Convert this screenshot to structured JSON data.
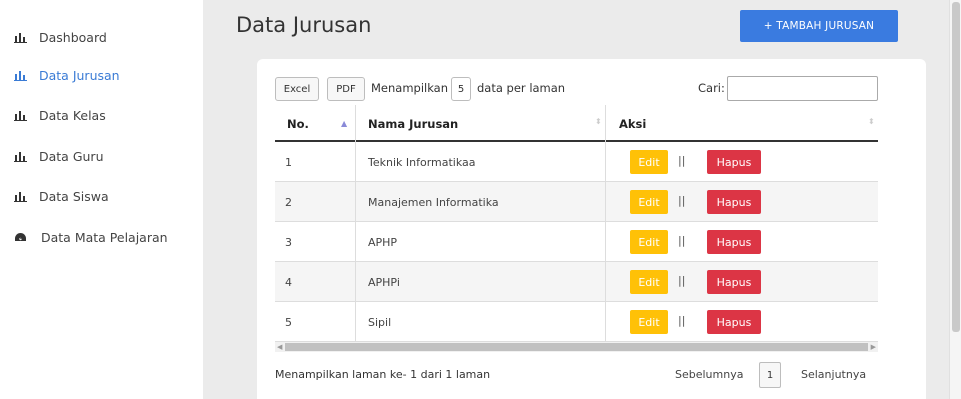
{
  "sidebar": {
    "items": [
      {
        "label": "Dashboard",
        "icon": "bar-chart-icon",
        "active": false
      },
      {
        "label": "Data Jurusan",
        "icon": "bar-chart-icon",
        "active": true
      },
      {
        "label": "Data Kelas",
        "icon": "bar-chart-icon",
        "active": false
      },
      {
        "label": "Data Guru",
        "icon": "bar-chart-icon",
        "active": false
      },
      {
        "label": "Data Siswa",
        "icon": "bar-chart-icon",
        "active": false
      },
      {
        "label": "Data Mata Pelajaran",
        "icon": "gauge-icon",
        "active": false
      }
    ]
  },
  "header": {
    "title": "Data Jurusan",
    "add_button_label": "+ TAMBAH JURUSAN"
  },
  "toolbar": {
    "excel_label": "Excel",
    "pdf_label": "PDF",
    "length_prefix": "Menampilkan",
    "length_value": "5",
    "length_suffix": "data per laman",
    "search_label": "Cari:",
    "search_value": ""
  },
  "table": {
    "columns": [
      "No.",
      "Nama Jurusan",
      "Aksi"
    ],
    "rows": [
      {
        "no": "1",
        "nama": "Teknik Informatikaa"
      },
      {
        "no": "2",
        "nama": "Manajemen Informatika"
      },
      {
        "no": "3",
        "nama": "APHP"
      },
      {
        "no": "4",
        "nama": "APHPi"
      },
      {
        "no": "5",
        "nama": "Sipil"
      }
    ],
    "edit_label": "Edit",
    "separator": "||",
    "delete_label": "Hapus"
  },
  "footer": {
    "info": "Menampilkan laman ke- 1 dari 1 laman",
    "prev_label": "Sebelumnya",
    "page": "1",
    "next_label": "Selanjutnya"
  },
  "colors": {
    "accent": "#3a7be0",
    "edit": "#ffc107",
    "delete": "#dc3545",
    "active_nav": "#3a7bd5"
  }
}
